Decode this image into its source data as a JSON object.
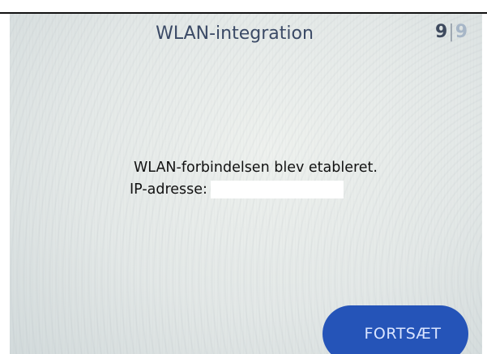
{
  "header": {
    "title": "WLAN-integration",
    "step_current": "9",
    "step_separator": "|",
    "step_total": "9"
  },
  "message": {
    "status": "WLAN-forbindelsen blev etableret.",
    "ip_label": "IP-adresse:",
    "ip_value": ""
  },
  "footer": {
    "continue_label": "FORTSÆT"
  },
  "colors": {
    "accent": "#2554b8",
    "title_text": "#3b4a66",
    "body_text": "#111111"
  }
}
